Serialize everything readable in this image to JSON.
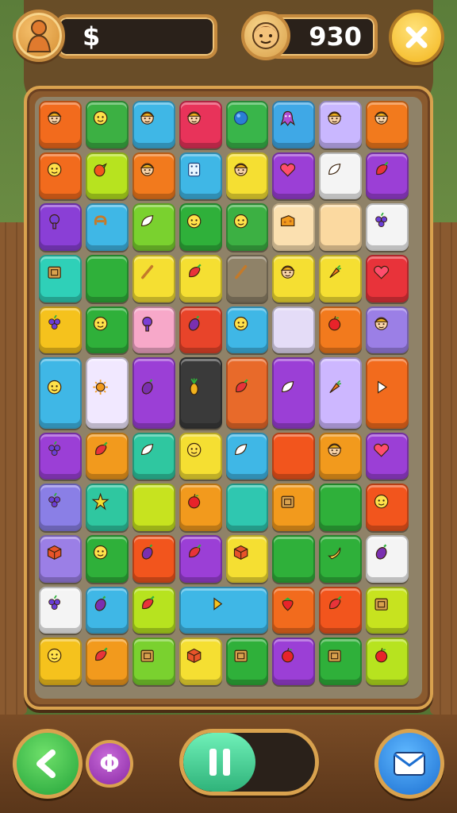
{
  "hud": {
    "currency_symbol": "$",
    "currency_value": "",
    "score": "930",
    "avatar_icon": "villager-icon",
    "score_icon": "face-icon",
    "close_icon": "close-icon"
  },
  "controls": {
    "back_icon": "back-arrow-icon",
    "small_label": "Φ",
    "pause_icon": "pause-icon",
    "pause_progress": 0.55,
    "mail_icon": "mail-icon"
  },
  "board": {
    "columns": 8,
    "rows": 11,
    "tiles": [
      {
        "c": 0,
        "r": 0,
        "color": "#f26b1d",
        "icon": "person"
      },
      {
        "c": 1,
        "r": 0,
        "color": "#3cb043",
        "icon": "face"
      },
      {
        "c": 2,
        "r": 0,
        "color": "#3fb7e6",
        "icon": "person"
      },
      {
        "c": 3,
        "r": 0,
        "color": "#e8335a",
        "icon": "person"
      },
      {
        "c": 4,
        "r": 0,
        "color": "#39b54a",
        "icon": "ball"
      },
      {
        "c": 5,
        "r": 0,
        "color": "#3fa8e6",
        "icon": "octopus"
      },
      {
        "c": 6,
        "r": 0,
        "color": "#c9b7ff",
        "icon": "person"
      },
      {
        "c": 7,
        "r": 0,
        "color": "#f27a1d",
        "icon": "person"
      },
      {
        "c": 0,
        "r": 1,
        "color": "#f26b1d",
        "icon": "face"
      },
      {
        "c": 1,
        "r": 1,
        "color": "#b7e31f",
        "icon": "fruit"
      },
      {
        "c": 2,
        "r": 1,
        "color": "#f27a1d",
        "icon": "person"
      },
      {
        "c": 3,
        "r": 1,
        "color": "#3fb7e6",
        "icon": "dice"
      },
      {
        "c": 4,
        "r": 1,
        "color": "#f5df32",
        "icon": "person"
      },
      {
        "c": 5,
        "r": 1,
        "color": "#9b3fd6",
        "icon": "heart"
      },
      {
        "c": 6,
        "r": 1,
        "color": "#f4f4f4",
        "icon": "leaf"
      },
      {
        "c": 7,
        "r": 1,
        "color": "#9b3fd6",
        "icon": "pepper"
      },
      {
        "c": 0,
        "r": 2,
        "color": "#8a3fd6",
        "icon": "tree"
      },
      {
        "c": 1,
        "r": 2,
        "color": "#3fb7e6",
        "icon": "pretzel"
      },
      {
        "c": 2,
        "r": 2,
        "color": "#7ad12f",
        "icon": "leaf"
      },
      {
        "c": 3,
        "r": 2,
        "color": "#2fb03a",
        "icon": "face"
      },
      {
        "c": 4,
        "r": 2,
        "color": "#3cb043",
        "icon": "face"
      },
      {
        "c": 5,
        "r": 2,
        "color": "#fbe0b0",
        "icon": "cheese"
      },
      {
        "c": 6,
        "r": 2,
        "color": "#fbd9a0",
        "icon": "none"
      },
      {
        "c": 7,
        "r": 2,
        "color": "#f4f4f4",
        "icon": "grapes"
      },
      {
        "c": 0,
        "r": 3,
        "color": "#2fd0b8",
        "icon": "box"
      },
      {
        "c": 1,
        "r": 3,
        "color": "#2fb03a",
        "icon": "none"
      },
      {
        "c": 2,
        "r": 3,
        "color": "#f5df32",
        "icon": "stick"
      },
      {
        "c": 3,
        "r": 3,
        "color": "#f5df32",
        "icon": "pepper"
      },
      {
        "c": 4,
        "r": 3,
        "color": "#8f8268",
        "icon": "stick"
      },
      {
        "c": 5,
        "r": 3,
        "color": "#f5df32",
        "icon": "person"
      },
      {
        "c": 6,
        "r": 3,
        "color": "#f5df32",
        "icon": "carrot"
      },
      {
        "c": 7,
        "r": 3,
        "color": "#e8333a",
        "icon": "heart"
      },
      {
        "c": 0,
        "r": 4,
        "color": "#f5c21d",
        "icon": "grapes"
      },
      {
        "c": 1,
        "r": 4,
        "color": "#2fb03a",
        "icon": "face"
      },
      {
        "c": 2,
        "r": 4,
        "color": "#f7a8c9",
        "icon": "tree"
      },
      {
        "c": 3,
        "r": 4,
        "color": "#e8442a",
        "icon": "eggplant"
      },
      {
        "c": 4,
        "r": 4,
        "color": "#3fb7e6",
        "icon": "face"
      },
      {
        "c": 5,
        "r": 4,
        "color": "#e4dcf7",
        "icon": "none"
      },
      {
        "c": 6,
        "r": 4,
        "color": "#f27a1d",
        "icon": "apple"
      },
      {
        "c": 7,
        "r": 4,
        "color": "#9b7fe6",
        "icon": "person"
      },
      {
        "c": 0,
        "r": 5,
        "color": "#3fb7e6",
        "icon": "face",
        "h": 1.5
      },
      {
        "c": 1,
        "r": 5,
        "color": "#f1e8ff",
        "icon": "sun",
        "h": 1.5
      },
      {
        "c": 2,
        "r": 5,
        "color": "#9b3fd6",
        "icon": "eggplant",
        "h": 1.5
      },
      {
        "c": 3,
        "r": 5,
        "color": "#3a3a3a",
        "icon": "pineapple",
        "h": 1.5
      },
      {
        "c": 4,
        "r": 5,
        "color": "#e86a2a",
        "icon": "pepper",
        "h": 1.5
      },
      {
        "c": 5,
        "r": 5,
        "color": "#9b3fd6",
        "icon": "leaf",
        "h": 1.5
      },
      {
        "c": 6,
        "r": 5,
        "color": "#cdb7ff",
        "icon": "carrot",
        "h": 1.5
      },
      {
        "c": 7,
        "r": 5,
        "color": "#f26b1d",
        "icon": "play",
        "h": 1.5
      },
      {
        "c": 0,
        "r": 6,
        "color": "#9b3fd6",
        "icon": "grapes"
      },
      {
        "c": 1,
        "r": 6,
        "color": "#f29a1d",
        "icon": "pepper"
      },
      {
        "c": 2,
        "r": 6,
        "color": "#2fc7a0",
        "icon": "leaf"
      },
      {
        "c": 3,
        "r": 6,
        "color": "#f5df32",
        "icon": "face"
      },
      {
        "c": 4,
        "r": 6,
        "color": "#3fb7e6",
        "icon": "leaf"
      },
      {
        "c": 5,
        "r": 6,
        "color": "#f2551d",
        "icon": "none"
      },
      {
        "c": 6,
        "r": 6,
        "color": "#f29a1d",
        "icon": "person"
      },
      {
        "c": 7,
        "r": 6,
        "color": "#9b3fd6",
        "icon": "heart"
      },
      {
        "c": 0,
        "r": 7,
        "color": "#8a7fe6",
        "icon": "grapes"
      },
      {
        "c": 1,
        "r": 7,
        "color": "#2fc7a0",
        "icon": "star"
      },
      {
        "c": 2,
        "r": 7,
        "color": "#c7e31f",
        "icon": "none"
      },
      {
        "c": 3,
        "r": 7,
        "color": "#f29a1d",
        "icon": "apple"
      },
      {
        "c": 4,
        "r": 7,
        "color": "#2fc7b0",
        "icon": "none"
      },
      {
        "c": 5,
        "r": 7,
        "color": "#f29a1d",
        "icon": "box"
      },
      {
        "c": 6,
        "r": 7,
        "color": "#2fb03a",
        "icon": "none"
      },
      {
        "c": 7,
        "r": 7,
        "color": "#f2551d",
        "icon": "face"
      },
      {
        "c": 0,
        "r": 8,
        "color": "#9b7fe6",
        "icon": "cube"
      },
      {
        "c": 1,
        "r": 8,
        "color": "#2fb03a",
        "icon": "face"
      },
      {
        "c": 2,
        "r": 8,
        "color": "#f2551d",
        "icon": "eggplant"
      },
      {
        "c": 3,
        "r": 8,
        "color": "#9b3fd6",
        "icon": "pepper"
      },
      {
        "c": 4,
        "r": 8,
        "color": "#f5df32",
        "icon": "cube"
      },
      {
        "c": 5,
        "r": 8,
        "color": "#2fb03a",
        "icon": "none"
      },
      {
        "c": 6,
        "r": 8,
        "color": "#2fb03a",
        "icon": "banana"
      },
      {
        "c": 7,
        "r": 8,
        "color": "#f4f4f4",
        "icon": "eggplant"
      },
      {
        "c": 0,
        "r": 9,
        "color": "#f4f4f4",
        "icon": "grapes"
      },
      {
        "c": 1,
        "r": 9,
        "color": "#3fb7e6",
        "icon": "eggplant"
      },
      {
        "c": 2,
        "r": 9,
        "color": "#b7e31f",
        "icon": "pepper"
      },
      {
        "c": 3,
        "r": 9,
        "color": "#3fb7e6",
        "icon": "flag",
        "w": 2
      },
      {
        "c": 5,
        "r": 9,
        "color": "#f26b1d",
        "icon": "strawberry"
      },
      {
        "c": 6,
        "r": 9,
        "color": "#f2551d",
        "icon": "pepper"
      },
      {
        "c": 7,
        "r": 9,
        "color": "#c7e31f",
        "icon": "box"
      },
      {
        "c": 0,
        "r": 10,
        "color": "#f5c21d",
        "icon": "face"
      },
      {
        "c": 1,
        "r": 10,
        "color": "#f29a1d",
        "icon": "pepper"
      },
      {
        "c": 2,
        "r": 10,
        "color": "#7ad12f",
        "icon": "box"
      },
      {
        "c": 3,
        "r": 10,
        "color": "#f5df32",
        "icon": "cube"
      },
      {
        "c": 4,
        "r": 10,
        "color": "#2fb03a",
        "icon": "box"
      },
      {
        "c": 5,
        "r": 10,
        "color": "#9b3fd6",
        "icon": "apple"
      },
      {
        "c": 6,
        "r": 10,
        "color": "#2fb03a",
        "icon": "box"
      },
      {
        "c": 7,
        "r": 10,
        "color": "#b7e31f",
        "icon": "apple"
      }
    ]
  }
}
